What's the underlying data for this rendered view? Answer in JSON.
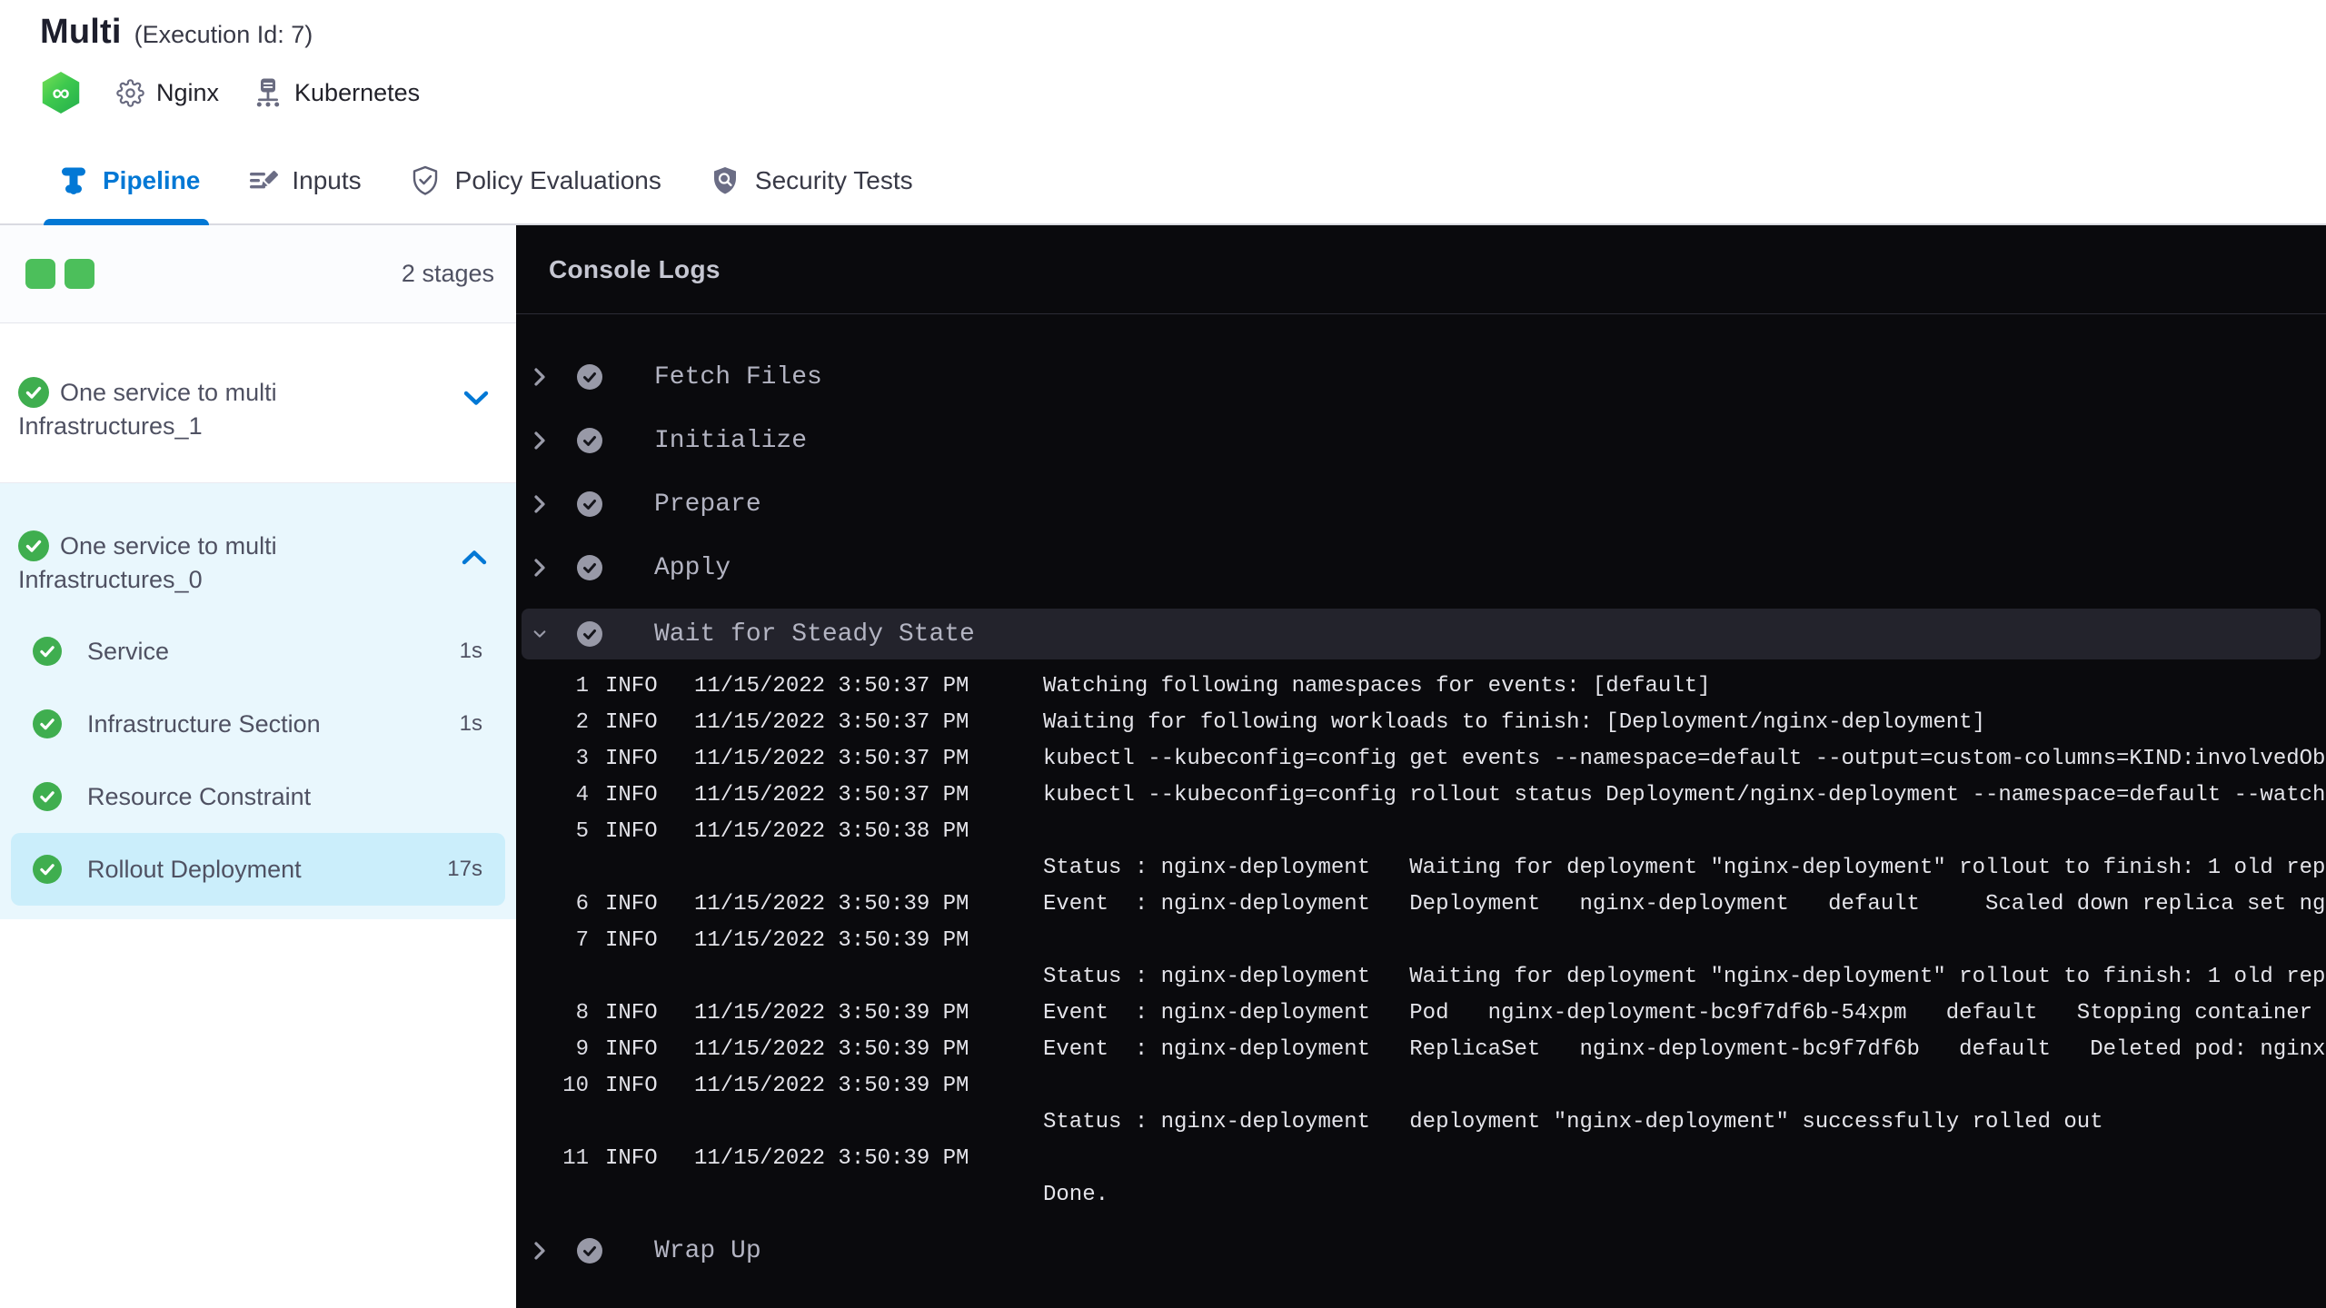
{
  "header": {
    "title": "Multi",
    "execution_id": "(Execution Id: 7)",
    "harness_logo_glyph": "∞",
    "harness_logo_color": "#3ec94e",
    "services": [
      {
        "icon": "gear-icon",
        "label": "Nginx"
      },
      {
        "icon": "environment-icon",
        "label": "Kubernetes"
      }
    ]
  },
  "tabs": [
    {
      "icon": "pipeline-icon",
      "label": "Pipeline",
      "active": true
    },
    {
      "icon": "inputs-icon",
      "label": "Inputs",
      "active": false
    },
    {
      "icon": "shield-check-icon",
      "label": "Policy Evaluations",
      "active": false
    },
    {
      "icon": "shield-search-icon",
      "label": "Security Tests",
      "active": false
    }
  ],
  "sidebar": {
    "stage_count_label": "2 stages",
    "stage_square_color": "#4cbf5b",
    "stages": [
      {
        "name": "One service to multi Infrastructures_1",
        "status": "success",
        "expanded": false
      },
      {
        "name": "One service to multi Infrastructures_0",
        "status": "success",
        "expanded": true,
        "steps": [
          {
            "name": "Service",
            "duration": "1s",
            "status": "success",
            "selected": false
          },
          {
            "name": "Infrastructure Section",
            "duration": "1s",
            "status": "success",
            "selected": false
          },
          {
            "name": "Resource Constraint",
            "duration": "",
            "status": "success",
            "selected": false
          },
          {
            "name": "Rollout Deployment",
            "duration": "17s",
            "status": "success",
            "selected": true
          }
        ]
      }
    ]
  },
  "console": {
    "title": "Console Logs",
    "steps": [
      {
        "name": "Fetch Files",
        "status": "success",
        "expanded": false
      },
      {
        "name": "Initialize",
        "status": "success",
        "expanded": false
      },
      {
        "name": "Prepare",
        "status": "success",
        "expanded": false
      },
      {
        "name": "Apply",
        "status": "success",
        "expanded": false
      },
      {
        "name": "Wait for Steady State",
        "status": "success",
        "expanded": true
      },
      {
        "name": "Wrap Up",
        "status": "success",
        "expanded": false
      }
    ],
    "log_lines": [
      {
        "num": "1",
        "level": "INFO",
        "timestamp": "11/15/2022 3:50:37 PM",
        "message": "Watching following namespaces for events: [default]"
      },
      {
        "num": "2",
        "level": "INFO",
        "timestamp": "11/15/2022 3:50:37 PM",
        "message": "Waiting for following workloads to finish: [Deployment/nginx-deployment]"
      },
      {
        "num": "3",
        "level": "INFO",
        "timestamp": "11/15/2022 3:50:37 PM",
        "message": "kubectl --kubeconfig=config get events --namespace=default --output=custom-columns=KIND:involvedOb"
      },
      {
        "num": "4",
        "level": "INFO",
        "timestamp": "11/15/2022 3:50:37 PM",
        "message": "kubectl --kubeconfig=config rollout status Deployment/nginx-deployment --namespace=default --watch"
      },
      {
        "num": "5",
        "level": "INFO",
        "timestamp": "11/15/2022 3:50:38 PM",
        "message": ""
      },
      {
        "num": "",
        "level": "",
        "timestamp": "",
        "message": "Status : nginx-deployment   Waiting for deployment \"nginx-deployment\" rollout to finish: 1 old rep"
      },
      {
        "num": "6",
        "level": "INFO",
        "timestamp": "11/15/2022 3:50:39 PM",
        "message": "Event  : nginx-deployment   Deployment   nginx-deployment   default     Scaled down replica set ng"
      },
      {
        "num": "7",
        "level": "INFO",
        "timestamp": "11/15/2022 3:50:39 PM",
        "message": ""
      },
      {
        "num": "",
        "level": "",
        "timestamp": "",
        "message": "Status : nginx-deployment   Waiting for deployment \"nginx-deployment\" rollout to finish: 1 old rep"
      },
      {
        "num": "8",
        "level": "INFO",
        "timestamp": "11/15/2022 3:50:39 PM",
        "message": "Event  : nginx-deployment   Pod   nginx-deployment-bc9f7df6b-54xpm   default   Stopping container"
      },
      {
        "num": "9",
        "level": "INFO",
        "timestamp": "11/15/2022 3:50:39 PM",
        "message": "Event  : nginx-deployment   ReplicaSet   nginx-deployment-bc9f7df6b   default   Deleted pod: nginx"
      },
      {
        "num": "10",
        "level": "INFO",
        "timestamp": "11/15/2022 3:50:39 PM",
        "message": ""
      },
      {
        "num": "",
        "level": "",
        "timestamp": "",
        "message": "Status : nginx-deployment   deployment \"nginx-deployment\" successfully rolled out"
      },
      {
        "num": "11",
        "level": "INFO",
        "timestamp": "11/15/2022 3:50:39 PM",
        "message": ""
      },
      {
        "num": "",
        "level": "",
        "timestamp": "",
        "message": "Done."
      }
    ]
  },
  "colors": {
    "accent_blue": "#0278d5",
    "success_green": "#3fae4f",
    "stage_square_green": "#4cbf5b",
    "expanded_stage_bg": "#e9f7fd",
    "selected_step_bg": "#cbeefb",
    "console_bg": "#0a0a0d",
    "console_highlight_bg": "#23232c"
  }
}
